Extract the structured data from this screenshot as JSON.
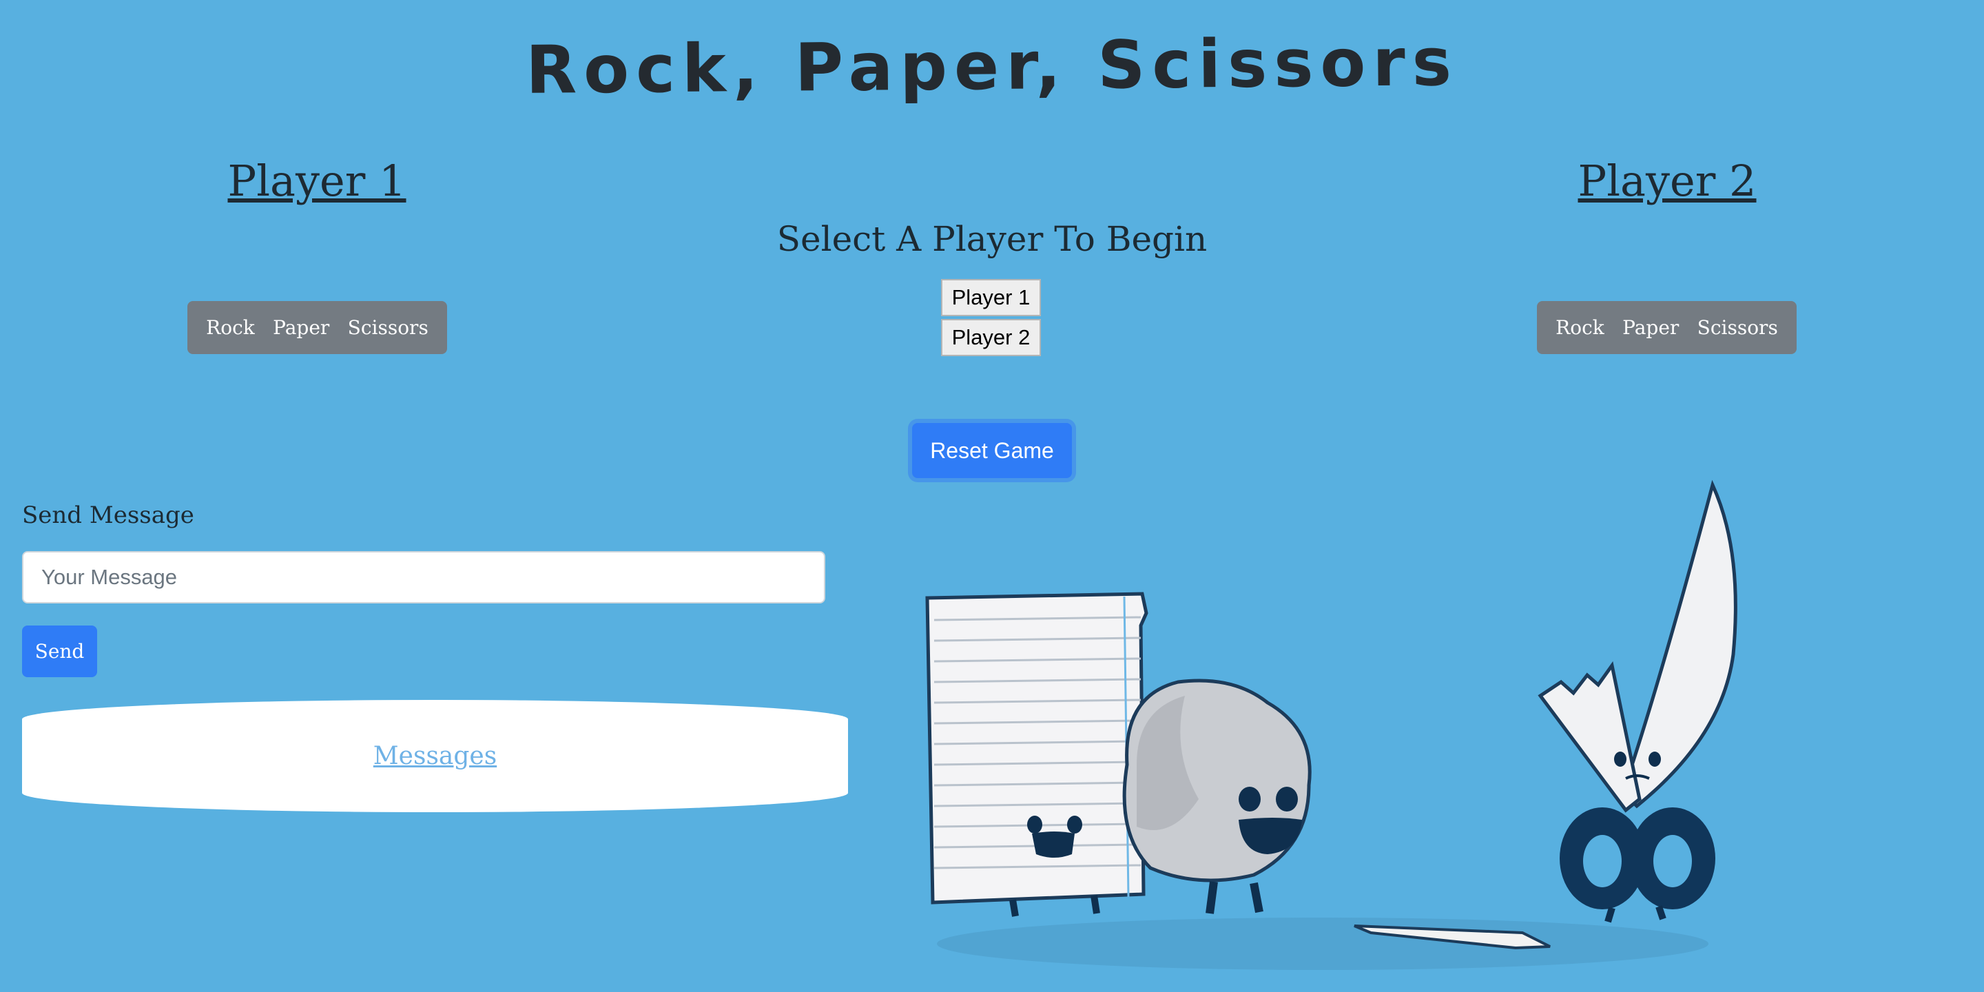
{
  "title": "Rock, Paper, Scissors",
  "player1": {
    "heading": "Player 1",
    "choices": [
      "Rock",
      "Paper",
      "Scissors"
    ]
  },
  "player2": {
    "heading": "Player 2",
    "choices": [
      "Rock",
      "Paper",
      "Scissors"
    ]
  },
  "status": "Select A Player To Begin",
  "select_buttons": [
    "Player 1",
    "Player 2"
  ],
  "reset_label": "Reset Game",
  "chat": {
    "label": "Send Message",
    "placeholder": "Your Message",
    "send_label": "Send",
    "messages_link": "Messages"
  },
  "illustration": {
    "icons": [
      "paper-character-icon",
      "rock-character-icon",
      "scissors-character-icon"
    ]
  },
  "colors": {
    "background": "#58b0e0",
    "primary": "#2f7cf6",
    "button_group": "#747b82"
  }
}
